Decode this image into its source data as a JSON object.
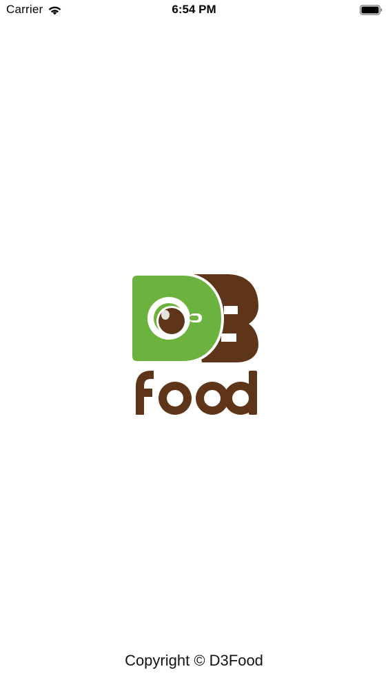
{
  "status_bar": {
    "carrier": "Carrier",
    "time": "6:54 PM",
    "wifi_icon": "wifi-icon",
    "battery_icon": "battery-icon"
  },
  "logo": {
    "brand": "D3food",
    "colors": {
      "green": "#6cb23f",
      "brown": "#5e3519",
      "white": "#ffffff"
    }
  },
  "footer": {
    "copyright": "Copyright © D3Food"
  }
}
